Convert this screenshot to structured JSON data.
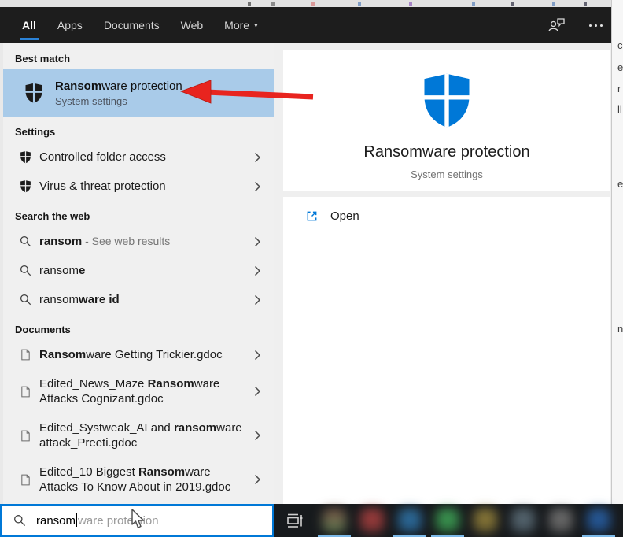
{
  "colors": {
    "accent": "#0078d7",
    "best_match_highlight": "#a9cbe9",
    "annotation_arrow": "#e8241f",
    "topbar_bg": "#1d1d1d",
    "taskbar_bg": "#171a1d"
  },
  "topbar": {
    "tabs": [
      {
        "label": "All",
        "active": true
      },
      {
        "label": "Apps",
        "active": false
      },
      {
        "label": "Documents",
        "active": false
      },
      {
        "label": "Web",
        "active": false
      },
      {
        "label": "More",
        "active": false,
        "caret": true
      }
    ]
  },
  "best_match": {
    "header": "Best match",
    "title_bold": "Ransom",
    "title_rest": "ware protection",
    "subtitle": "System settings",
    "icon": "defender-shield"
  },
  "sections": [
    {
      "header": "Settings",
      "items": [
        {
          "icon": "shield",
          "lines": [
            [
              [
                "Controlled folder access",
                0
              ]
            ]
          ]
        },
        {
          "icon": "shield",
          "lines": [
            [
              [
                "Virus & threat protection",
                0
              ]
            ]
          ]
        }
      ]
    },
    {
      "header": "Search the web",
      "items": [
        {
          "icon": "search",
          "lines": [
            [
              [
                "ransom",
                1
              ],
              [
                " - See web results",
                2
              ]
            ]
          ]
        },
        {
          "icon": "search",
          "lines": [
            [
              [
                "ransom",
                0
              ],
              [
                "e",
                1
              ]
            ]
          ]
        },
        {
          "icon": "search",
          "lines": [
            [
              [
                "ransom",
                0
              ],
              [
                "ware id",
                1
              ]
            ]
          ]
        }
      ]
    },
    {
      "header": "Documents",
      "items": [
        {
          "icon": "doc",
          "lines": [
            [
              [
                "Ransom",
                1
              ],
              [
                "ware Getting Trickier.gdoc",
                0
              ]
            ]
          ]
        },
        {
          "icon": "doc",
          "lines": [
            [
              [
                "Edited_News_Maze ",
                0
              ],
              [
                "Ransom",
                1
              ],
              [
                "ware",
                0
              ]
            ],
            [
              [
                "Attacks Cognizant.gdoc",
                0
              ]
            ]
          ]
        },
        {
          "icon": "doc",
          "lines": [
            [
              [
                "Edited_Systweak_AI and ",
                0
              ],
              [
                "ransom",
                1
              ],
              [
                "ware",
                0
              ]
            ],
            [
              [
                "attack_Preeti.gdoc",
                0
              ]
            ]
          ]
        },
        {
          "icon": "doc",
          "lines": [
            [
              [
                "Edited_10 Biggest ",
                0
              ],
              [
                "Ransom",
                1
              ],
              [
                "ware",
                0
              ]
            ],
            [
              [
                "Attacks To Know About in 2019.gdoc",
                0
              ]
            ]
          ]
        }
      ]
    }
  ],
  "preview": {
    "title": "Ransomware protection",
    "subtitle": "System settings",
    "open_label": "Open",
    "icon": "defender-shield"
  },
  "search_box": {
    "typed": "ransom",
    "suggestion": "ware protection"
  },
  "taskbar": {
    "icons": [
      {
        "c1": "#7a5546",
        "c2": "#5c7a50",
        "active": true
      },
      {
        "c1": "#a33e3e",
        "c2": "#7e3434",
        "active": false
      },
      {
        "c1": "#2f6f9e",
        "c2": "#255a85",
        "active": true
      },
      {
        "c1": "#3f9e55",
        "c2": "#2f7a42",
        "active": true
      },
      {
        "c1": "#8f7d3a",
        "c2": "#6f6230",
        "active": false
      },
      {
        "c1": "#5a6b75",
        "c2": "#47555e",
        "active": false
      },
      {
        "c1": "#6f6f6f",
        "c2": "#595959",
        "active": false
      },
      {
        "c1": "#2a5fa0",
        "c2": "#1f4a80",
        "active": true
      }
    ]
  },
  "background_edge_fragments": [
    "c",
    "e",
    "r",
    "ll",
    "e",
    "n"
  ]
}
